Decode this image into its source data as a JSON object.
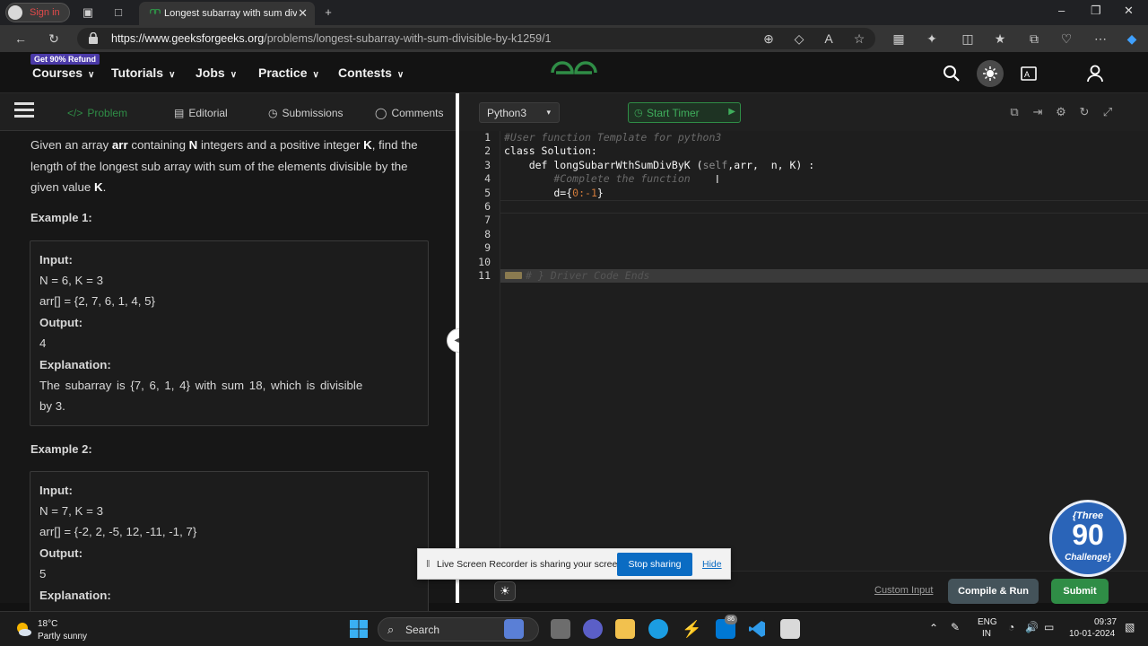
{
  "browser": {
    "profile_label": "Sign in",
    "tab_title": "Longest subarray with sum divisib",
    "url_host": "https://www.geeksforgeeks.org",
    "url_path": "/problems/longest-subarray-with-sum-divisible-by-k1259/1"
  },
  "site_header": {
    "refund_badge": "Get 90% Refund",
    "nav": [
      "Courses",
      "Tutorials",
      "Jobs",
      "Practice",
      "Contests"
    ]
  },
  "left_tabs": {
    "problem": "Problem",
    "editorial": "Editorial",
    "submissions": "Submissions",
    "comments": "Comments"
  },
  "problem": {
    "p1": "Given an array ",
    "arr": "arr",
    "p2": " containing ",
    "n": "N",
    "p3": " integers and a positive integer ",
    "k": "K",
    "p4": ", find the length of the longest sub array with sum of the elements divisible by the given value ",
    "k2": "K",
    "p5": "."
  },
  "example1": {
    "title": "Example 1:",
    "input_label": "Input:",
    "input_nk": "N = 6, K = 3",
    "input_arr": "arr[] = {2, 7, 6, 1, 4, 5}",
    "output_label": "Output:",
    "output_val": "4",
    "expl_label": "Explanation:",
    "expl_line1": "The subarray is {7, 6, 1, 4} with sum 18, which is divisible",
    "expl_line2": "by 3."
  },
  "example2": {
    "title": "Example 2:",
    "input_label": "Input:",
    "input_nk": "N = 7, K = 3",
    "input_arr": "arr[] = {-2, 2, -5, 12, -11, -1, 7}",
    "output_label": "Output:",
    "output_val": "5",
    "expl_label": "Explanation:"
  },
  "editor": {
    "language": "Python3",
    "start_timer": "Start Timer",
    "line_numbers": [
      "1",
      "2",
      "3",
      "4",
      "5",
      "6",
      "7",
      "8",
      "9",
      "10",
      "11"
    ],
    "code_line1": "#User function Template for python3",
    "code_line2": "class Solution:",
    "code_line3a": "    def longSubarrWthSumDivByK (",
    "code_line3b": "self",
    "code_line3c": ",arr,  n, K) :",
    "code_line4": "        #Complete the function",
    "code_line5a": "        d={",
    "code_line5b": "0",
    "code_line5c": ":",
    "code_line5d": "-1",
    "code_line5e": "}",
    "code_line11": "# } Driver Code Ends"
  },
  "actions": {
    "custom_input": "Custom Input",
    "compile_run": "Compile & Run",
    "submit": "Submit"
  },
  "share_bar": {
    "message": "Live Screen Recorder is sharing your screen.",
    "stop": "Stop sharing",
    "hide": "Hide"
  },
  "badge": {
    "top": "{Three",
    "number": "90",
    "bottom": "Challenge}"
  },
  "taskbar": {
    "temp": "18°C",
    "condition": "Partly sunny",
    "search": "Search",
    "notif_count": "86",
    "lang1": "ENG",
    "lang2": "IN",
    "time": "09:37",
    "date": "10-01-2024"
  },
  "colors": {
    "gfg_green": "#2f8d46",
    "stop_blue": "#0b6cc3",
    "badge_blue": "#2a64b8"
  }
}
